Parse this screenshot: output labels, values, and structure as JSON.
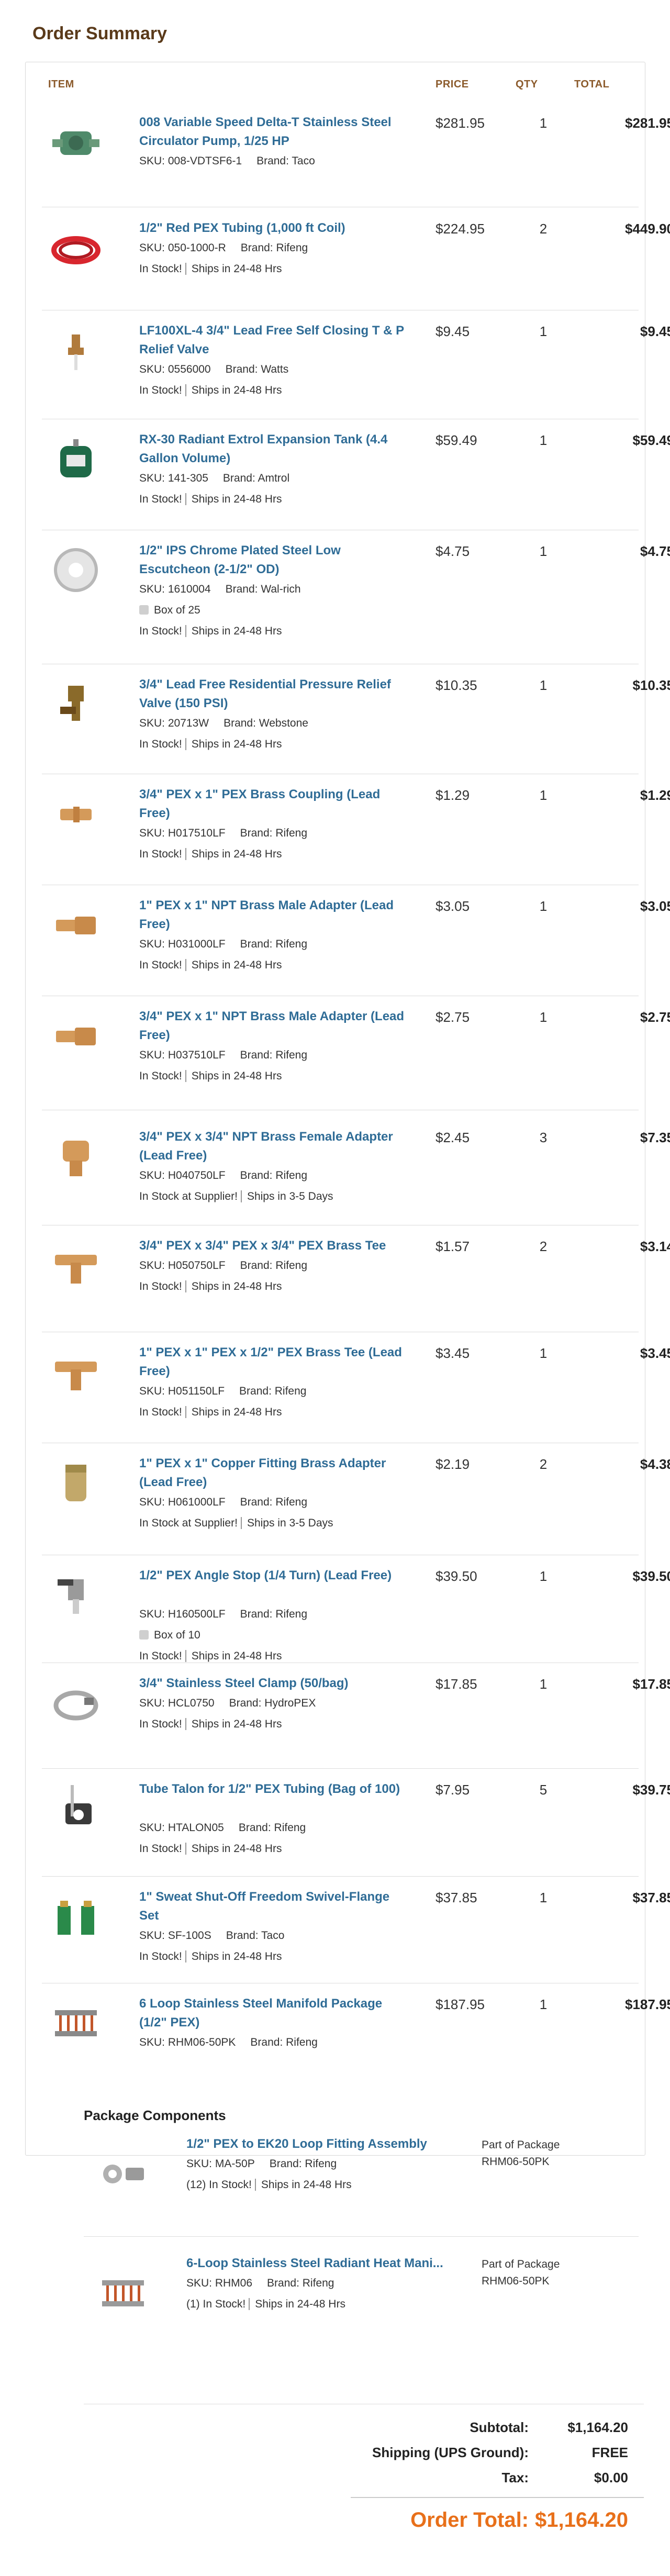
{
  "title": "Order Summary",
  "columns": {
    "item": "ITEM",
    "price": "PRICE",
    "qty": "QTY",
    "total": "TOTAL"
  },
  "items": [
    {
      "name": "008 Variable Speed Delta-T Stainless Steel Circulator Pump, 1/25 HP",
      "sku": "SKU: 008-VDTSF6-1",
      "brand": "Brand: Taco",
      "stock": "",
      "ships": "",
      "box": "",
      "price": "$281.95",
      "qty": "1",
      "total": "$281.95",
      "icon": "circulator-pump-icon",
      "color": "#4f8a6a"
    },
    {
      "name": "1/2\" Red PEX Tubing (1,000 ft Coil)",
      "sku": "SKU: 050-1000-R",
      "brand": "Brand: Rifeng",
      "stock": "In Stock!",
      "ships": "Ships in 24-48 Hrs",
      "box": "",
      "price": "$224.95",
      "qty": "2",
      "total": "$449.90",
      "icon": "pex-coil-icon",
      "color": "#d8262e"
    },
    {
      "name": "LF100XL-4 3/4\" Lead Free Self Closing T & P Relief Valve",
      "sku": "SKU: 0556000",
      "brand": "Brand: Watts",
      "stock": "In Stock!",
      "ships": "Ships in 24-48 Hrs",
      "box": "",
      "price": "$9.45",
      "qty": "1",
      "total": "$9.45",
      "icon": "relief-valve-icon",
      "color": "#b07a3c"
    },
    {
      "name": "RX-30 Radiant Extrol Expansion Tank (4.4 Gallon Volume)",
      "sku": "SKU: 141-305",
      "brand": "Brand: Amtrol",
      "stock": "In Stock!",
      "ships": "Ships in 24-48 Hrs",
      "box": "",
      "price": "$59.49",
      "qty": "1",
      "total": "$59.49",
      "icon": "expansion-tank-icon",
      "color": "#1f6a48"
    },
    {
      "name": "1/2\" IPS Chrome Plated Steel Low Escutcheon (2-1/2\" OD)",
      "sku": "SKU: 1610004",
      "brand": "Brand: Wal-rich",
      "stock": "In Stock!",
      "ships": "Ships in 24-48 Hrs",
      "box": "Box of 25",
      "price": "$4.75",
      "qty": "1",
      "total": "$4.75",
      "icon": "escutcheon-icon",
      "color": "#b8b8b8"
    },
    {
      "name": "3/4\" Lead Free Residential Pressure Relief Valve (150 PSI)",
      "sku": "SKU: 20713W",
      "brand": "Brand: Webstone",
      "stock": "In Stock!",
      "ships": "Ships in 24-48 Hrs",
      "box": "",
      "price": "$10.35",
      "qty": "1",
      "total": "$10.35",
      "icon": "pressure-relief-valve-icon",
      "color": "#8a6a2a"
    },
    {
      "name": "3/4\" PEX x 1\" PEX Brass Coupling (Lead Free)",
      "sku": "SKU: H017510LF",
      "brand": "Brand: Rifeng",
      "stock": "In Stock!",
      "ships": "Ships in 24-48 Hrs",
      "box": "",
      "price": "$1.29",
      "qty": "1",
      "total": "$1.29",
      "icon": "brass-coupling-icon",
      "color": "#d49a5a"
    },
    {
      "name": "1\" PEX x 1\" NPT Brass Male Adapter (Lead Free)",
      "sku": "SKU: H031000LF",
      "brand": "Brand: Rifeng",
      "stock": "In Stock!",
      "ships": "Ships in 24-48 Hrs",
      "box": "",
      "price": "$3.05",
      "qty": "1",
      "total": "$3.05",
      "icon": "male-adapter-icon",
      "color": "#d49a5a"
    },
    {
      "name": "3/4\" PEX x 1\" NPT Brass Male Adapter (Lead Free)",
      "sku": "SKU: H037510LF",
      "brand": "Brand: Rifeng",
      "stock": "In Stock!",
      "ships": "Ships in 24-48 Hrs",
      "box": "",
      "price": "$2.75",
      "qty": "1",
      "total": "$2.75",
      "icon": "male-adapter-icon",
      "color": "#d49a5a"
    },
    {
      "name": "3/4\" PEX x 3/4\" NPT Brass Female Adapter (Lead Free)",
      "sku": "SKU: H040750LF",
      "brand": "Brand: Rifeng",
      "stock": "In Stock at Supplier!",
      "ships": "Ships in 3-5 Days",
      "box": "",
      "price": "$2.45",
      "qty": "3",
      "total": "$7.35",
      "icon": "female-adapter-icon",
      "color": "#d49a5a"
    },
    {
      "name": "3/4\" PEX x 3/4\" PEX x 3/4\" PEX Brass Tee",
      "sku": "SKU: H050750LF",
      "brand": "Brand: Rifeng",
      "stock": "In Stock!",
      "ships": "Ships in 24-48 Hrs",
      "box": "",
      "price": "$1.57",
      "qty": "2",
      "total": "$3.14",
      "icon": "brass-tee-icon",
      "color": "#d49a5a"
    },
    {
      "name": "1\" PEX x 1\" PEX x 1/2\" PEX Brass Tee (Lead Free)",
      "sku": "SKU: H051150LF",
      "brand": "Brand: Rifeng",
      "stock": "In Stock!",
      "ships": "Ships in 24-48 Hrs",
      "box": "",
      "price": "$3.45",
      "qty": "1",
      "total": "$3.45",
      "icon": "brass-tee-icon",
      "color": "#d49a5a"
    },
    {
      "name": "1\" PEX x 1\" Copper Fitting Brass Adapter (Lead Free)",
      "sku": "SKU: H061000LF",
      "brand": "Brand: Rifeng",
      "stock": "In Stock at Supplier!",
      "ships": "Ships in 3-5 Days",
      "box": "",
      "price": "$2.19",
      "qty": "2",
      "total": "$4.38",
      "icon": "copper-adapter-icon",
      "color": "#c2a86a"
    },
    {
      "name": "1/2\" PEX Angle Stop (1/4 Turn) (Lead Free)",
      "sku": "SKU: H160500LF",
      "brand": "Brand: Rifeng",
      "stock": "In Stock!",
      "ships": "Ships in 24-48 Hrs",
      "box": "Box of 10",
      "price": "$39.50",
      "qty": "1",
      "total": "$39.50",
      "icon": "angle-stop-icon",
      "color": "#9a9a9a"
    },
    {
      "name": "3/4\" Stainless Steel Clamp (50/bag)",
      "sku": "SKU: HCL0750",
      "brand": "Brand: HydroPEX",
      "stock": "In Stock!",
      "ships": "Ships in 24-48 Hrs",
      "box": "",
      "price": "$17.85",
      "qty": "1",
      "total": "$17.85",
      "icon": "clamp-icon",
      "color": "#a8a8a8"
    },
    {
      "name": "Tube Talon for 1/2\" PEX Tubing (Bag of 100)",
      "sku": "SKU: HTALON05",
      "brand": "Brand: Rifeng",
      "stock": "In Stock!",
      "ships": "Ships in 24-48 Hrs",
      "box": "",
      "price": "$7.95",
      "qty": "5",
      "total": "$39.75",
      "icon": "tube-talon-icon",
      "color": "#3a3a3a"
    },
    {
      "name": "1\" Sweat Shut-Off Freedom Swivel-Flange Set",
      "sku": "SKU: SF-100S",
      "brand": "Brand: Taco",
      "stock": "In Stock!",
      "ships": "Ships in 24-48 Hrs",
      "box": "",
      "price": "$37.85",
      "qty": "1",
      "total": "$37.85",
      "icon": "flange-set-icon",
      "color": "#2a8a4a"
    },
    {
      "name": "6 Loop Stainless Steel Manifold Package (1/2\" PEX)",
      "sku": "SKU: RHM06-50PK",
      "brand": "Brand: Rifeng",
      "stock": "",
      "ships": "",
      "box": "",
      "price": "$187.95",
      "qty": "1",
      "total": "$187.95",
      "icon": "manifold-icon",
      "color": "#8a8a8a"
    }
  ],
  "package": {
    "title": "Package Components",
    "components": [
      {
        "name": "1/2\" PEX to EK20 Loop Fitting Assembly",
        "sku": "SKU: MA-50P",
        "brand": "Brand: Rifeng",
        "stock": "(12) In Stock!",
        "ships": "Ships in 24-48 Hrs",
        "part_label": "Part of Package",
        "part_sku": "RHM06-50PK",
        "icon": "loop-fitting-icon"
      },
      {
        "name": "6-Loop Stainless Steel Radiant Heat Mani...",
        "sku": "SKU: RHM06",
        "brand": "Brand: Rifeng",
        "stock": "(1) In Stock!",
        "ships": "Ships in 24-48 Hrs",
        "part_label": "Part of Package",
        "part_sku": "RHM06-50PK",
        "icon": "manifold-icon"
      }
    ]
  },
  "totals": {
    "subtotal_label": "Subtotal:",
    "subtotal": "$1,164.20",
    "shipping_label": "Shipping (UPS Ground):",
    "shipping": "FREE",
    "tax_label": "Tax:",
    "tax": "$0.00",
    "grand_label": "Order Total:",
    "grand": "$1,164.20"
  },
  "colors": {
    "link": "#2f6c96",
    "accent": "#e8701a",
    "header": "#8b5a2b",
    "title": "#5a3a1a"
  }
}
